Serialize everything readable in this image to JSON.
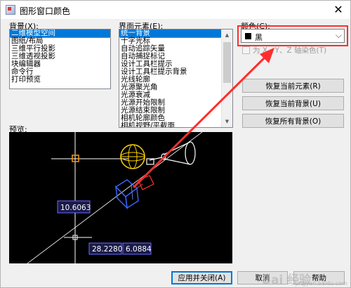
{
  "window": {
    "title": "图形窗口颜色"
  },
  "context": {
    "label": "背景(X):",
    "items": [
      "二维模型空间",
      "图纸/布局",
      "三维平行投影",
      "三维透视投影",
      "块编辑器",
      "命令行",
      "打印预览"
    ],
    "selected_index": 0
  },
  "elements": {
    "label": "界面元素(E):",
    "items": [
      "统一背景",
      "十字光标",
      "自动追踪矢量",
      "自动捕捉标记",
      "设计工具栏提示",
      "设计工具栏提示背景",
      "光线轮廓",
      "光源聚光角",
      "光源衰减",
      "光源开始限制",
      "光源结束限制",
      "相机轮廓颜色",
      "相机视野/平截面"
    ],
    "selected_index": 0
  },
  "color": {
    "label": "颜色(C):",
    "value": "黑",
    "swatch_color": "#000000"
  },
  "tint": {
    "label": "为 X、Y、Z 轴染色(T)",
    "checked": false,
    "enabled": false
  },
  "buttons": {
    "restore_element": "恢复当前元素(R)",
    "restore_context": "恢复当前背景(U)",
    "restore_all": "恢复所有背景(O)",
    "apply_close": "应用并关闭(A)",
    "cancel": "取消",
    "help": "帮助"
  },
  "preview": {
    "label": "预览:",
    "dimensions": [
      "10.6063",
      "28.2280",
      "6.0884"
    ]
  },
  "watermark": {
    "text": "Bai 经验",
    "sub": "jingyan.baidu.com"
  },
  "colors": {
    "accent": "#0078d7",
    "annotation": "#ff2d2d",
    "preview_bg": "#000000",
    "crosshair": "#ffffff",
    "autosnap": "#ff9900",
    "dimension_box": "#4a4ad6"
  }
}
